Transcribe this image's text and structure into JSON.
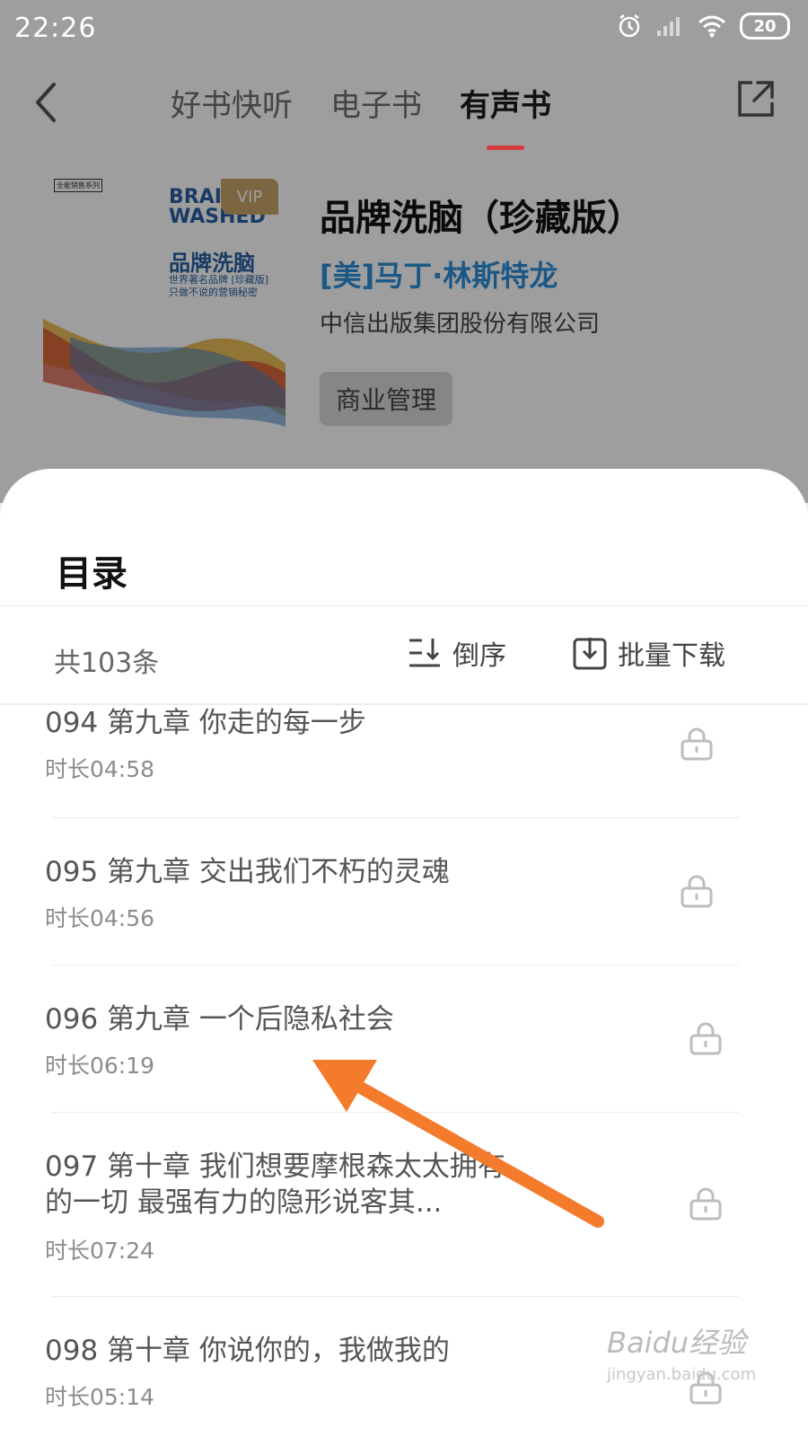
{
  "status": {
    "time": "22:26",
    "battery": "20"
  },
  "nav": {
    "tabs": [
      {
        "label": "好书快听"
      },
      {
        "label": "电子书"
      },
      {
        "label": "有声书"
      }
    ],
    "active_tab": "有声书"
  },
  "book": {
    "cover": {
      "series": "全能销售系列",
      "title_en": "BRAIN WASHED",
      "title_cn": "品牌洗脑",
      "subtitle_line1": "世界著名品牌 [珍藏版]",
      "subtitle_line2": "只做不说的营销秘密",
      "vip": "VIP"
    },
    "title": "品牌洗脑（珍藏版）",
    "author": "[美]马丁·林斯特龙",
    "publisher": "中信出版集团股份有限公司",
    "tag": "商业管理"
  },
  "catalog": {
    "title": "目录",
    "count": "共103条",
    "sort_label": "倒序",
    "download_label": "批量下载",
    "items": [
      {
        "title": "094 第九章 你走的每一步",
        "duration": "时长04:58",
        "icon": "lock-icon"
      },
      {
        "title": "095 第九章 交出我们不朽的灵魂",
        "duration": "时长04:56",
        "icon": "lock-icon"
      },
      {
        "title": "096 第九章 一个后隐私社会",
        "duration": "时长06:19",
        "icon": "lock-icon"
      },
      {
        "title": "097 第十章 我们想要摩根森太太拥有的一切 最强有力的隐形说客其...",
        "duration": "时长07:24",
        "icon": "lock-icon"
      },
      {
        "title": "098 第十章 你说你的，我做我的",
        "duration": "时长05:14",
        "icon": "lock-icon"
      }
    ]
  },
  "watermark": {
    "text": "Baidu经验",
    "sub": "jingyan.baidu.com"
  },
  "colors": {
    "accent": "#d63a3a",
    "author": "#2d8fd8",
    "annotation_arrow": "#f47a2c"
  }
}
